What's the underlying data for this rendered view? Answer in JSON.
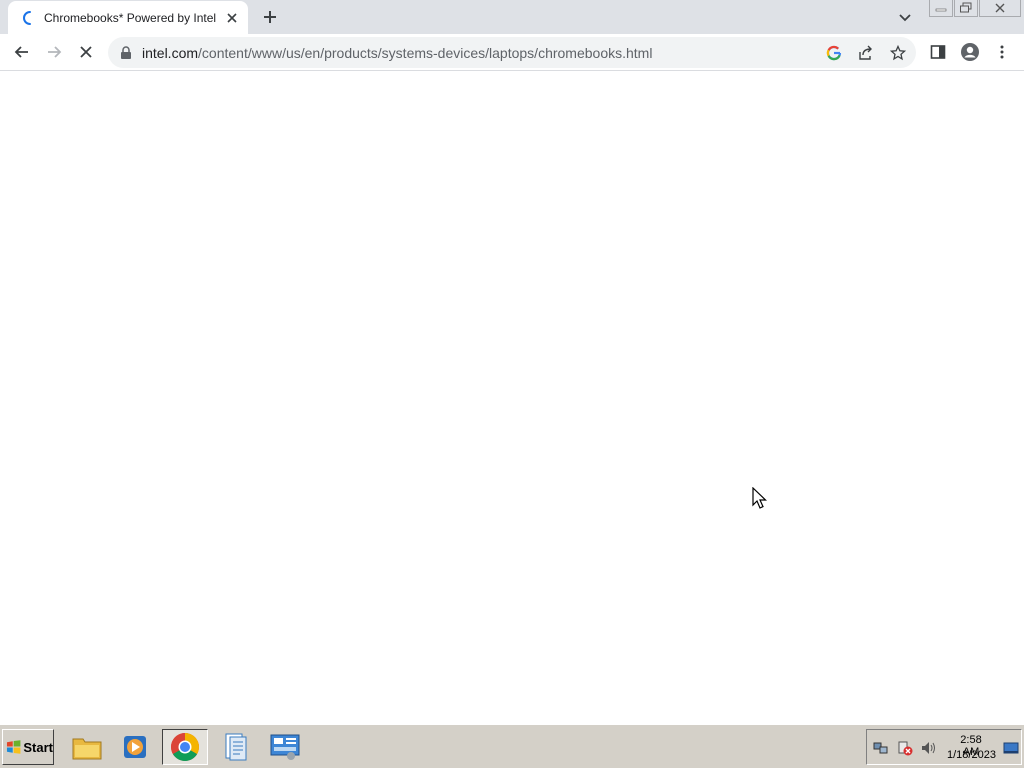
{
  "browser": {
    "tab": {
      "title": "Chromebooks* Powered by Intel",
      "loading": true
    },
    "new_tab_label": "+",
    "address": {
      "host": "intel.com",
      "path": "/content/www/us/en/products/systems-devices/laptops/chromebooks.html"
    },
    "toolbar_icons": [
      "back-icon",
      "forward-icon",
      "stop-reload-icon",
      "lock-icon",
      "google-icon",
      "share-icon",
      "bookmark-star-icon",
      "side-panel-icon",
      "profile-icon",
      "menu-kebab-icon"
    ]
  },
  "taskbar": {
    "start_label": "Start",
    "apps": [
      "file-explorer-icon",
      "media-player-icon",
      "chrome-icon",
      "document-icon",
      "control-panel-icon"
    ],
    "clock": {
      "time": "2:58 AM",
      "date": "1/18/2023"
    }
  },
  "colors": {
    "tab_strip": "#dee1e6",
    "omnibox": "#f1f3f4",
    "taskbar": "#d4d0c8",
    "accent": "#1a73e8"
  }
}
